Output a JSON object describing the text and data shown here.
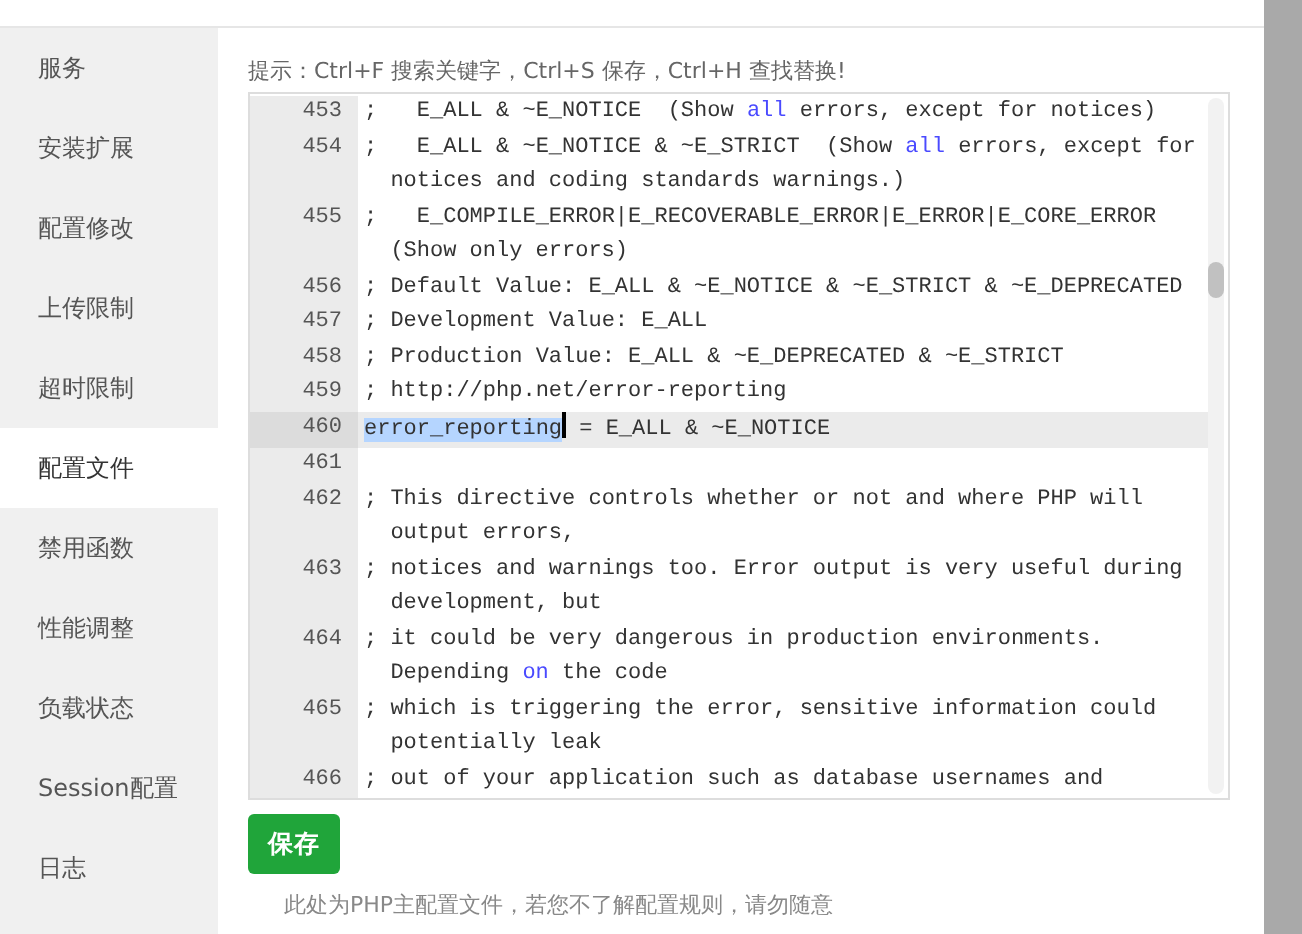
{
  "sidebar": {
    "items": [
      {
        "label": "服务",
        "selected": false
      },
      {
        "label": "安装扩展",
        "selected": false
      },
      {
        "label": "配置修改",
        "selected": false
      },
      {
        "label": "上传限制",
        "selected": false
      },
      {
        "label": "超时限制",
        "selected": false
      },
      {
        "label": "配置文件",
        "selected": true
      },
      {
        "label": "禁用函数",
        "selected": false
      },
      {
        "label": "性能调整",
        "selected": false
      },
      {
        "label": "负载状态",
        "selected": false
      },
      {
        "label": "Session配置",
        "selected": false
      },
      {
        "label": "日志",
        "selected": false
      }
    ]
  },
  "hint": "提示：Ctrl+F 搜索关键字，Ctrl+S 保存，Ctrl+H 查找替换!",
  "editor": {
    "lines": [
      {
        "number": "453",
        "active": false,
        "segments": [
          {
            "kind": "plain",
            "text": ";   E_ALL & ~E_NOTICE  (Show "
          },
          {
            "kind": "keyword",
            "text": "all"
          },
          {
            "kind": "plain",
            "text": " errors, except for notices)"
          }
        ]
      },
      {
        "number": "454",
        "active": false,
        "segments": [
          {
            "kind": "plain",
            "text": ";   E_ALL & ~E_NOTICE & ~E_STRICT  (Show "
          },
          {
            "kind": "keyword",
            "text": "all"
          },
          {
            "kind": "plain",
            "text": " errors, except for notices and coding standards warnings.)"
          }
        ]
      },
      {
        "number": "455",
        "active": false,
        "segments": [
          {
            "kind": "plain",
            "text": ";   E_COMPILE_ERROR|E_RECOVERABLE_ERROR|E_ERROR|E_CORE_ERROR (Show only errors)"
          }
        ]
      },
      {
        "number": "456",
        "active": false,
        "segments": [
          {
            "kind": "plain",
            "text": "; Default Value: E_ALL & ~E_NOTICE & ~E_STRICT & ~E_DEPRECATED"
          }
        ]
      },
      {
        "number": "457",
        "active": false,
        "segments": [
          {
            "kind": "plain",
            "text": "; Development Value: E_ALL"
          }
        ]
      },
      {
        "number": "458",
        "active": false,
        "segments": [
          {
            "kind": "plain",
            "text": "; Production Value: E_ALL & ~E_DEPRECATED & ~E_STRICT"
          }
        ]
      },
      {
        "number": "459",
        "active": false,
        "segments": [
          {
            "kind": "plain",
            "text": "; http://php.net/error-reporting"
          }
        ]
      },
      {
        "number": "460",
        "active": true,
        "segments": [
          {
            "kind": "selected",
            "text": "error_reporting"
          },
          {
            "kind": "cursor"
          },
          {
            "kind": "plain",
            "text": " = E_ALL & ~E_NOTICE"
          }
        ]
      },
      {
        "number": "461",
        "active": false
      },
      {
        "number": "462",
        "active": false,
        "segments": [
          {
            "kind": "plain",
            "text": "; This directive controls whether or not and where PHP will output errors,"
          }
        ]
      },
      {
        "number": "463",
        "active": false,
        "segments": [
          {
            "kind": "plain",
            "text": "; notices and warnings too. Error output is very useful during development, but"
          }
        ]
      },
      {
        "number": "464",
        "active": false,
        "segments": [
          {
            "kind": "plain",
            "text": "; it could be very dangerous in production environments. Depending "
          },
          {
            "kind": "keyword",
            "text": "on"
          },
          {
            "kind": "plain",
            "text": " the code"
          }
        ]
      },
      {
        "number": "465",
        "active": false,
        "segments": [
          {
            "kind": "plain",
            "text": "; which is triggering the error, sensitive information could potentially leak"
          }
        ]
      },
      {
        "number": "466",
        "active": false,
        "segments": [
          {
            "kind": "plain",
            "text": "; out of your application such as database usernames and"
          }
        ]
      }
    ]
  },
  "save_button": "保存",
  "note": "此处为PHP主配置文件，若您不了解配置规则，请勿随意"
}
